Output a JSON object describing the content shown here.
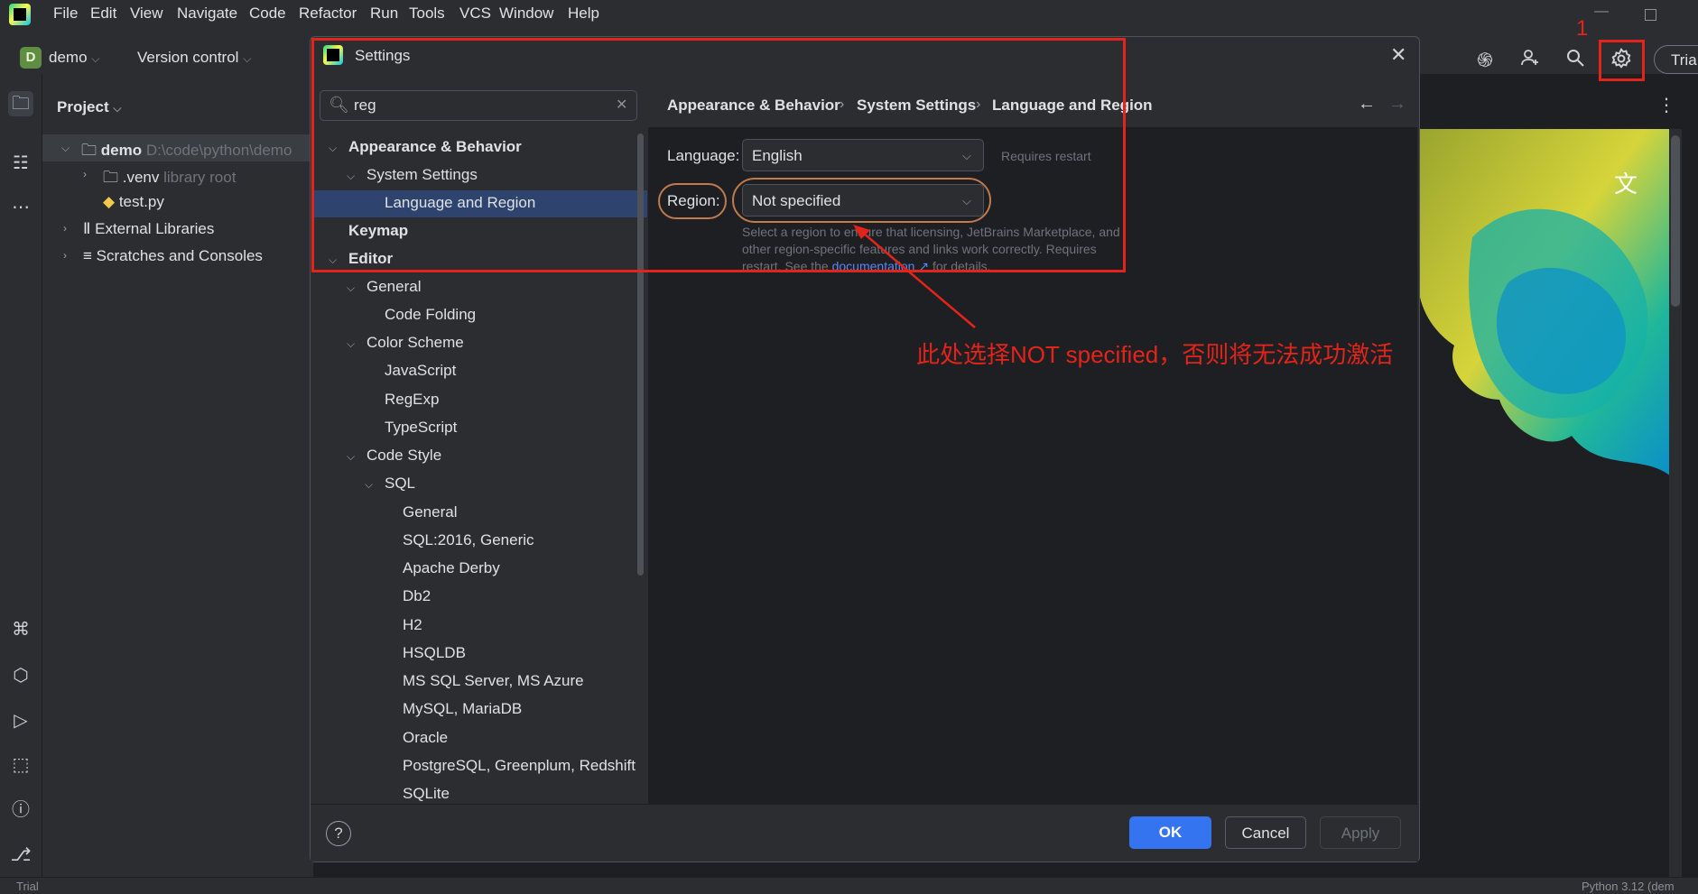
{
  "menubar": {
    "items": [
      "File",
      "Edit",
      "View",
      "Navigate",
      "Code",
      "Refactor",
      "Run",
      "Tools",
      "VCS",
      "Window",
      "Help"
    ]
  },
  "toolbar": {
    "project_badge": "D",
    "project_name": "demo",
    "version_control": "Version control",
    "trial_label": "Tria"
  },
  "project_panel": {
    "title": "Project",
    "tree": [
      {
        "label": "demo",
        "hint": "D:\\code\\python\\demo"
      },
      {
        "label": ".venv",
        "hint": "library root"
      },
      {
        "label": "test.py",
        "hint": ""
      },
      {
        "label": "External Libraries",
        "hint": ""
      },
      {
        "label": "Scratches and Consoles",
        "hint": ""
      }
    ]
  },
  "settings": {
    "title": "Settings",
    "search": {
      "value": "reg",
      "placeholder": ""
    },
    "tree": [
      "Appearance & Behavior",
      "System Settings",
      "Language and Region",
      "Keymap",
      "Editor",
      "General",
      "Code Folding",
      "Color Scheme",
      "JavaScript",
      "RegExp",
      "TypeScript",
      "Code Style",
      "SQL",
      "General",
      "SQL:2016, Generic",
      "Apache Derby",
      "Db2",
      "H2",
      "HSQLDB",
      "MS SQL Server, MS Azure",
      "MySQL, MariaDB",
      "Oracle",
      "PostgreSQL, Greenplum, Redshift",
      "SQLite"
    ],
    "breadcrumb": [
      "Appearance & Behavior",
      "System Settings",
      "Language and Region"
    ],
    "breadcrumb_sep": "›",
    "language_label": "Language:",
    "language_value": "English",
    "language_note": "Requires restart",
    "region_label": "Region:",
    "region_value": "Not specified",
    "region_help_1": "Select a region to ensure that licensing, JetBrains Marketplace, and other region-specific features and links work correctly. Requires restart. See the ",
    "region_help_link": "documentation ↗",
    "region_help_2": " for details.",
    "buttons": {
      "help": "?",
      "ok": "OK",
      "cancel": "Cancel",
      "apply": "Apply"
    }
  },
  "annotation": {
    "step_number": "1",
    "note": "此处选择NOT specified，否则将无法成功激活"
  },
  "statusbar": {
    "left": "Trial",
    "right": "Python 3.12 (dem"
  },
  "colors": {
    "accent": "#3574f0",
    "annotation_red": "#e3241b",
    "selection": "#2e436e"
  }
}
